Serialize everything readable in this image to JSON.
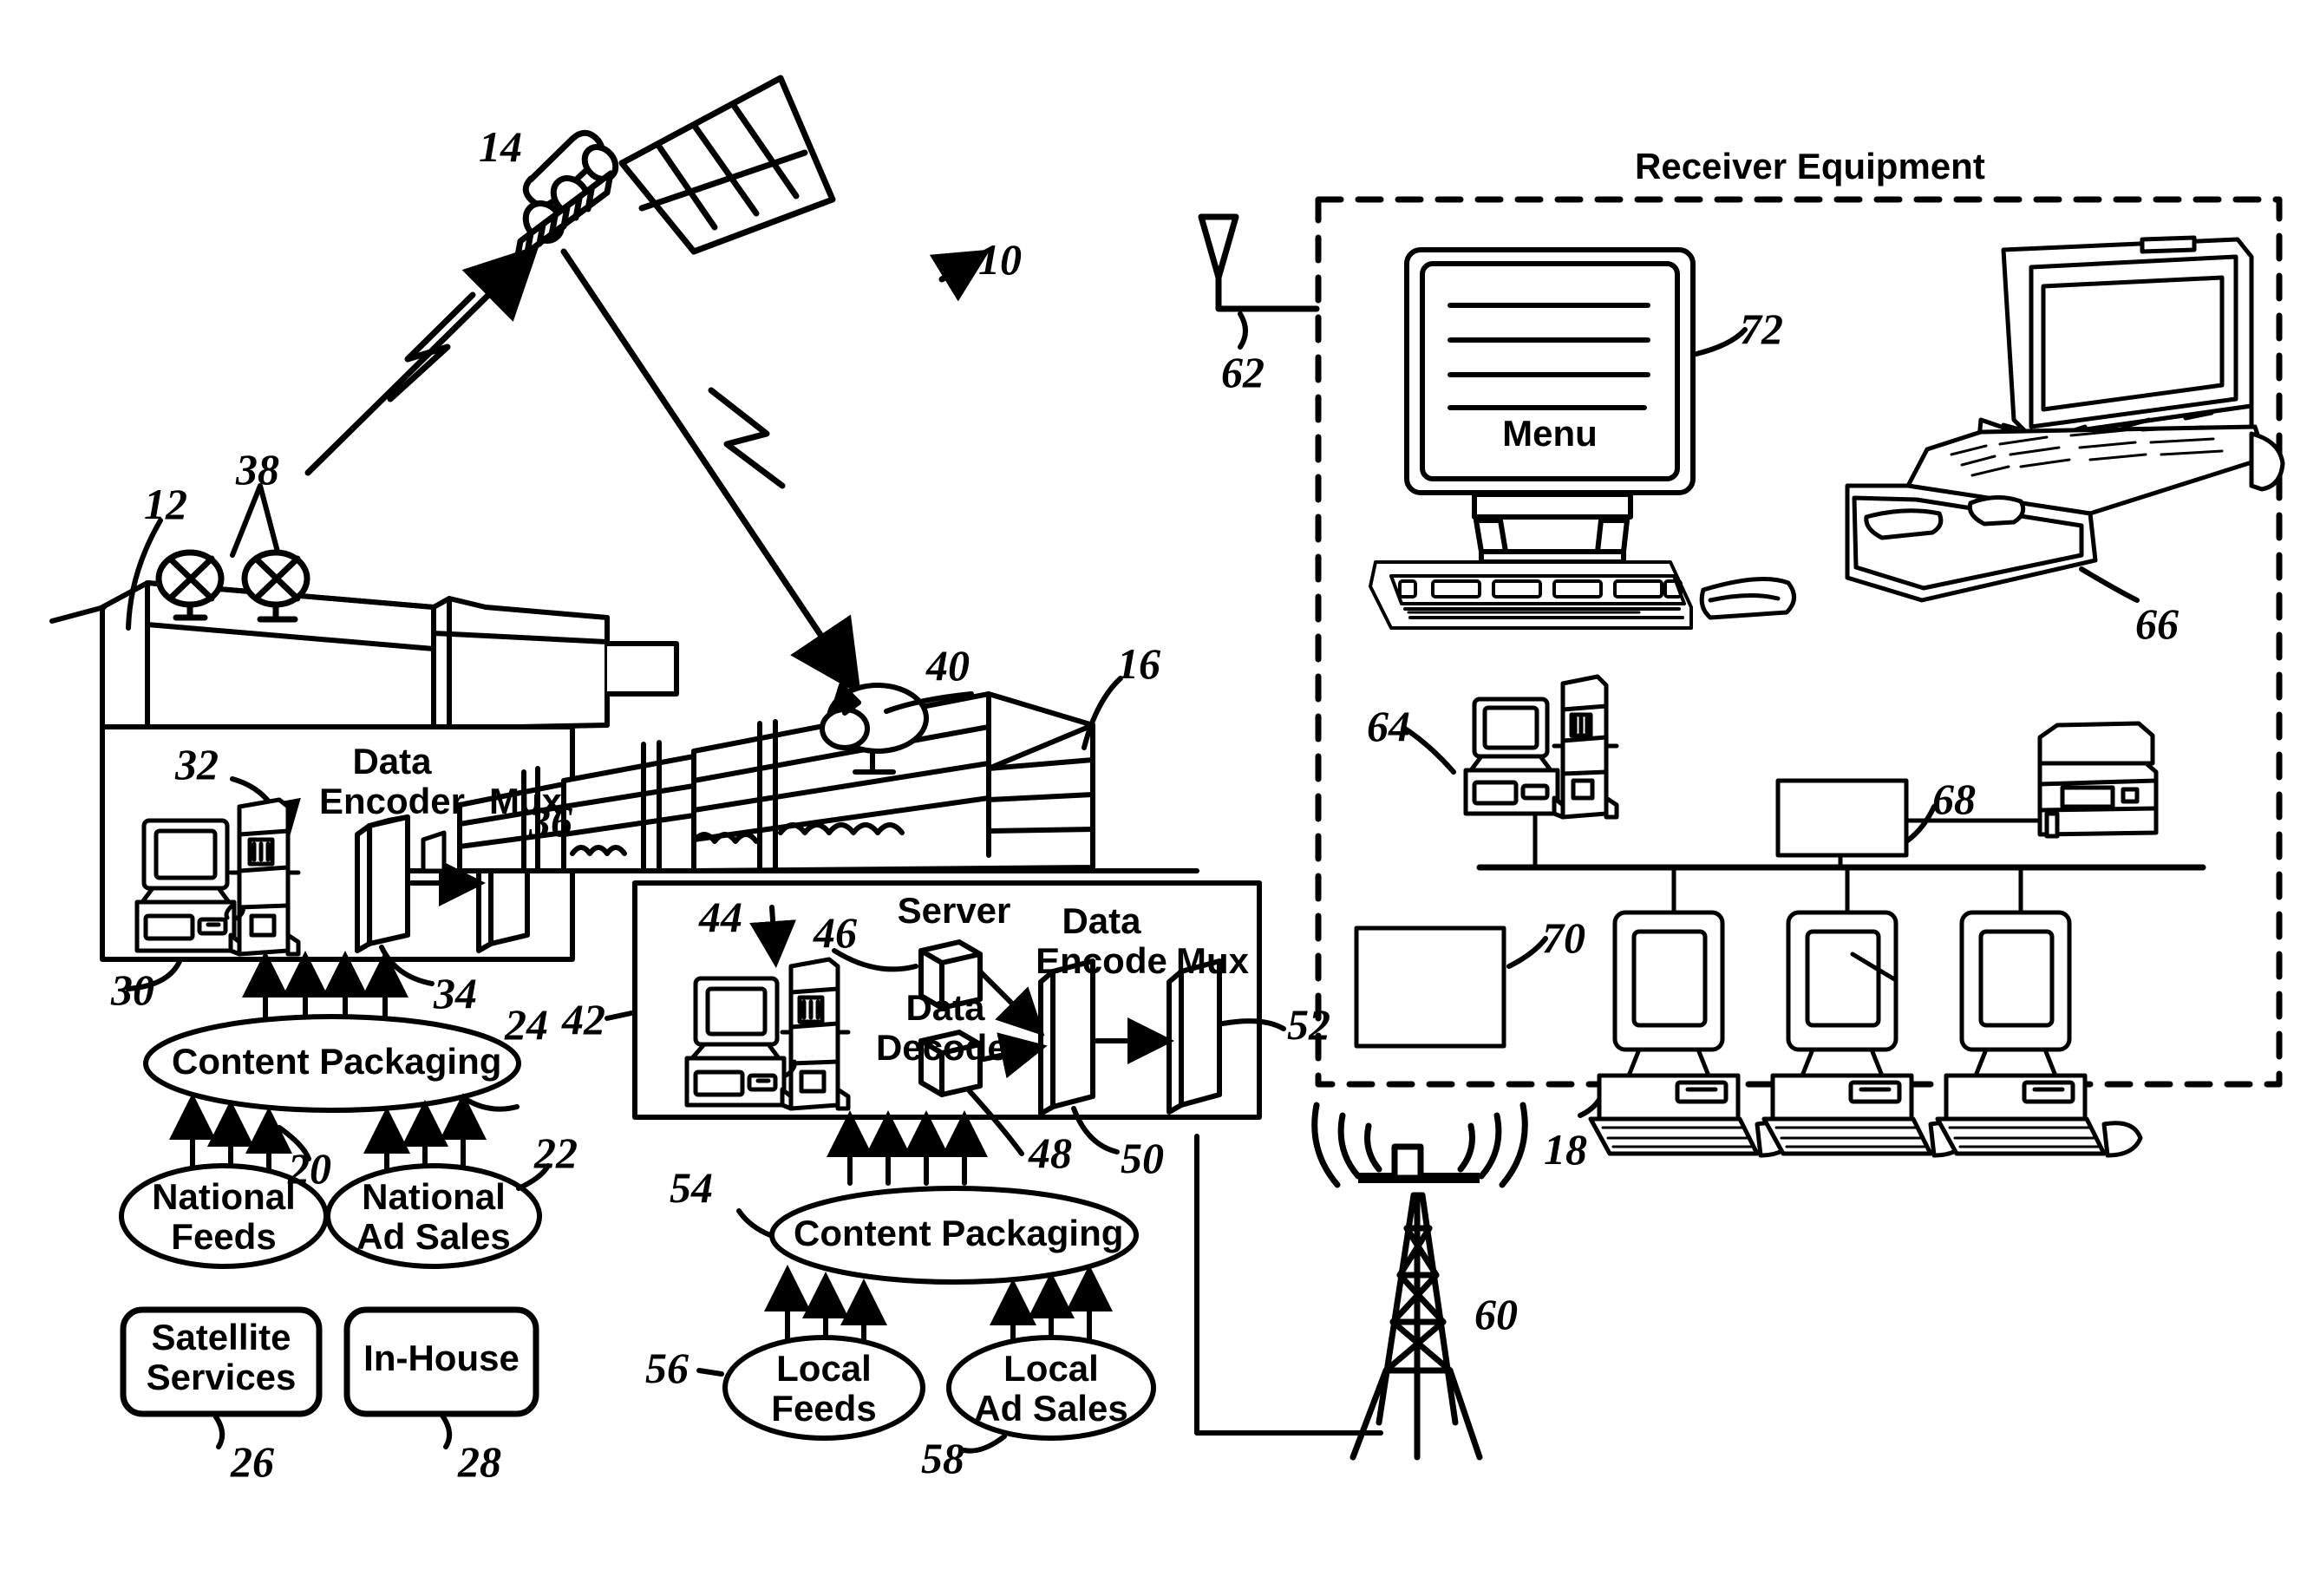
{
  "figure": {
    "title_sections": {
      "receiver_equipment": "Receiver Equipment"
    }
  },
  "broadcast_facility": {
    "ref": "12",
    "dish_ref": "38",
    "inner_box_ref": "30",
    "workstation_ref": "32",
    "data_encoder_label": "Data\nEncoder",
    "data_encoder_ref": "34",
    "mux_label": "Mux",
    "mux_ref": "36"
  },
  "satellite": {
    "ref": "14",
    "system_ref": "10"
  },
  "headend": {
    "building_ref": "16",
    "dish_ref": "40",
    "inner_box_ref": "42",
    "workstation_ref": "44",
    "server_label": "Server",
    "server_ref": "46",
    "data_encode_label": "Data\nEncode",
    "data_encode_ref": "50",
    "data_decoder_label": "Data\nDecoder",
    "data_decoder_ref": "48",
    "mux_label": "Mux",
    "mux_ref": "52"
  },
  "national_sources": {
    "content_packaging": {
      "label": "Content Packaging",
      "ref": "24"
    },
    "national_feeds": {
      "label": "National\nFeeds",
      "ref": "20"
    },
    "national_ad_sales": {
      "label": "National\nAd Sales",
      "ref": "22"
    },
    "satellite_services": {
      "label": "Satellite\nServices",
      "ref": "26"
    },
    "in_house": {
      "label": "In-House",
      "ref": "28"
    }
  },
  "local_sources": {
    "content_packaging": {
      "label": "Content Packaging",
      "ref": "54"
    },
    "local_feeds": {
      "label": "Local\nFeeds",
      "ref": "56"
    },
    "local_ad_sales": {
      "label": "Local\nAd Sales",
      "ref": "58"
    }
  },
  "tower": {
    "ref": "60"
  },
  "receiver": {
    "title": "Receiver Equipment",
    "enclosure_ref": "18",
    "antenna_ref": "62",
    "monitor_screen_text": "Menu",
    "monitor_ref": "72",
    "laptop_ref": "66",
    "server_ref": "64",
    "lan_ref": "68",
    "device_ref": "70"
  },
  "text_labels": {
    "data": "Data",
    "encoder": "Encoder",
    "encode": "Encode",
    "decoder": "Decoder",
    "mux": "Mux",
    "server": "Server",
    "menu": "Menu",
    "content_packaging": "Content Packaging",
    "national_feeds_1": "National",
    "national_feeds_2": "Feeds",
    "national_ad_1": "National",
    "national_ad_2": "Ad Sales",
    "satellite_1": "Satellite",
    "satellite_2": "Services",
    "in_house": "In-House",
    "local_feeds_1": "Local",
    "local_feeds_2": "Feeds",
    "local_ad_1": "Local",
    "local_ad_2": "Ad Sales",
    "receiver_equipment": "Receiver Equipment"
  },
  "ref_numbers": {
    "n10": "10",
    "n12": "12",
    "n14": "14",
    "n16": "16",
    "n18": "18",
    "n20": "20",
    "n22": "22",
    "n24": "24",
    "n26": "26",
    "n28": "28",
    "n30": "30",
    "n32": "32",
    "n34": "34",
    "n36": "36",
    "n38": "38",
    "n40": "40",
    "n42": "42",
    "n44": "44",
    "n46": "46",
    "n48": "48",
    "n50": "50",
    "n52": "52",
    "n54": "54",
    "n56": "56",
    "n58": "58",
    "n60": "60",
    "n62": "62",
    "n64": "64",
    "n66": "66",
    "n68": "68",
    "n70": "70",
    "n72": "72"
  },
  "colors": {
    "ink": "#000000",
    "paper": "#ffffff"
  }
}
